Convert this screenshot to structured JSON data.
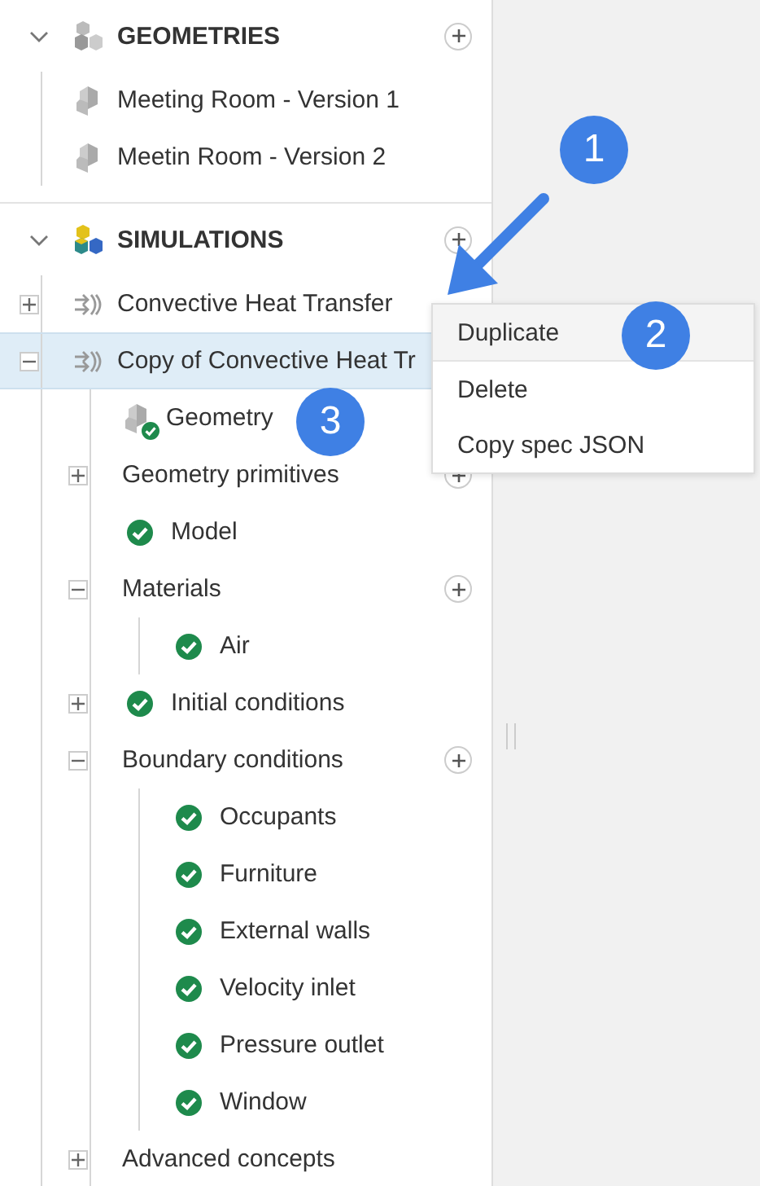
{
  "sections": [
    {
      "title": "GEOMETRIES",
      "kind": "geometries",
      "expanded": true,
      "add_button": true,
      "items": [
        {
          "label": "Meeting Room - Version 1",
          "kind": "geometry",
          "selected": false
        },
        {
          "label": "Meetin Room - Version 2",
          "kind": "geometry",
          "selected": false
        }
      ]
    },
    {
      "title": "SIMULATIONS",
      "kind": "simulations",
      "expanded": true,
      "add_button": true,
      "items": [
        {
          "label": "Convective Heat Transfer",
          "kind": "simulation",
          "expanded": false,
          "selected": false
        },
        {
          "label": "Copy of Convective Heat Tr",
          "kind": "simulation",
          "expanded": true,
          "selected": true,
          "children": [
            {
              "label": "Geometry",
              "kind": "geometry",
              "valid": true,
              "selected": false
            },
            {
              "label": "Geometry primitives",
              "kind": "group",
              "expanded": false,
              "add_button": true,
              "selected": false
            },
            {
              "label": "Model",
              "kind": "group",
              "valid": true,
              "selected": false
            },
            {
              "label": "Materials",
              "kind": "group",
              "expanded": true,
              "add_button": true,
              "selected": false,
              "children": [
                {
                  "label": "Air",
                  "kind": "group",
                  "valid": true,
                  "selected": false
                }
              ]
            },
            {
              "label": "Initial conditions",
              "kind": "group",
              "expanded": false,
              "valid": true,
              "selected": false
            },
            {
              "label": "Boundary conditions",
              "kind": "group",
              "expanded": true,
              "add_button": true,
              "selected": false,
              "children": [
                {
                  "label": "Occupants",
                  "kind": "group",
                  "valid": true,
                  "selected": false
                },
                {
                  "label": "Furniture",
                  "kind": "group",
                  "valid": true,
                  "selected": false
                },
                {
                  "label": "External walls",
                  "kind": "group",
                  "valid": true,
                  "selected": false
                },
                {
                  "label": "Velocity inlet",
                  "kind": "group",
                  "valid": true,
                  "selected": false
                },
                {
                  "label": "Pressure outlet",
                  "kind": "group",
                  "valid": true,
                  "selected": false
                },
                {
                  "label": "Window",
                  "kind": "group",
                  "valid": true,
                  "selected": false
                }
              ]
            },
            {
              "label": "Advanced concepts",
              "kind": "group",
              "expanded": false,
              "selected": false
            }
          ]
        }
      ]
    }
  ],
  "context_menu": {
    "items": [
      {
        "label": "Duplicate",
        "hovered": true
      },
      {
        "label": "Delete",
        "hovered": false
      },
      {
        "label": "Copy spec JSON",
        "hovered": false
      }
    ]
  },
  "callouts": [
    {
      "number": "1"
    },
    {
      "number": "2"
    },
    {
      "number": "3"
    }
  ]
}
